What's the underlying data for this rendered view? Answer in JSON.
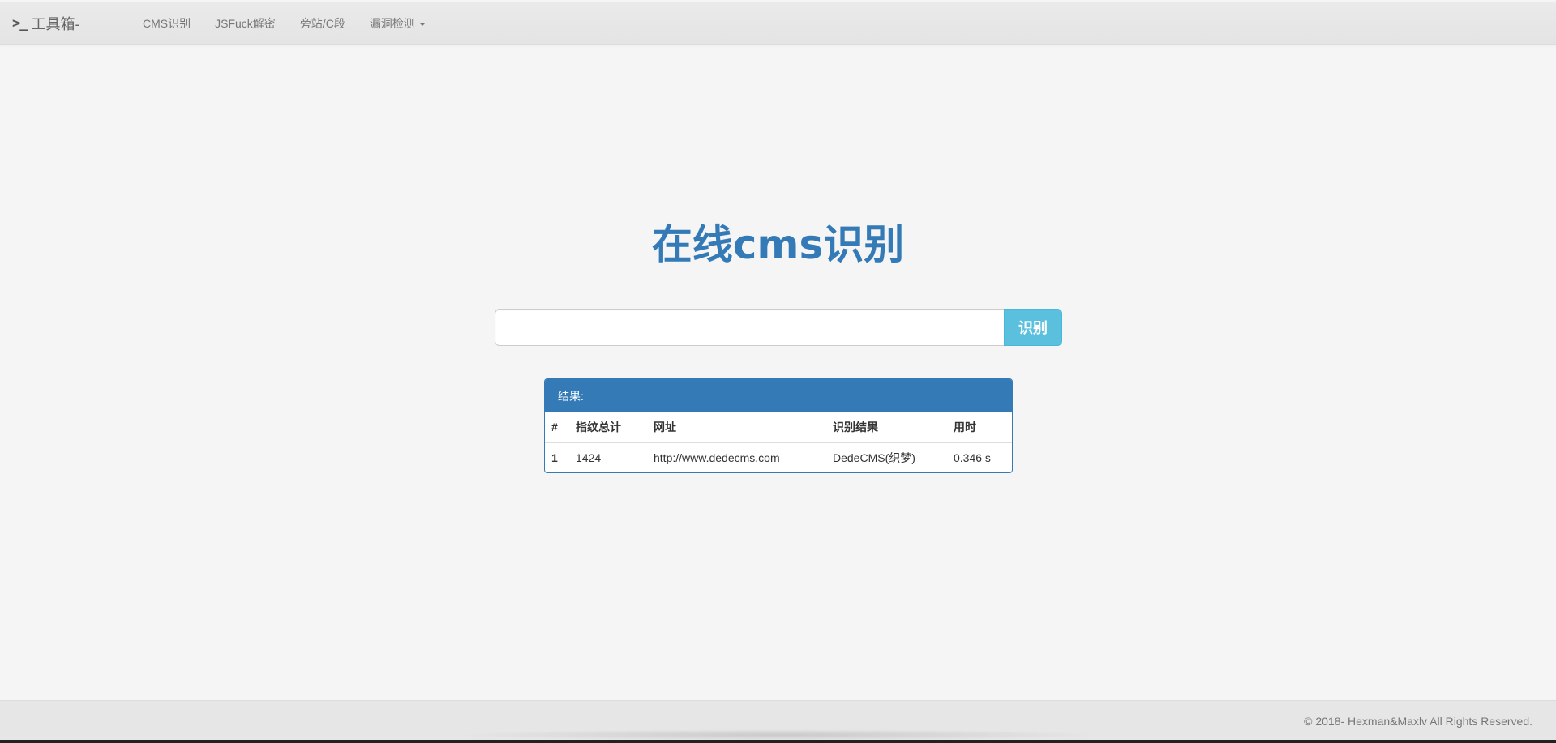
{
  "navbar": {
    "brand_icon": ">_",
    "brand_text": "工具箱-",
    "items": [
      {
        "label": "CMS识别"
      },
      {
        "label": "JSFuck解密"
      },
      {
        "label": "旁站/C段"
      },
      {
        "label": "漏洞检测",
        "has_dropdown": true
      }
    ]
  },
  "main": {
    "title": "在线cms识别",
    "search": {
      "value": "",
      "placeholder": "",
      "button_label": "识别"
    },
    "result": {
      "heading": "结果:",
      "columns": [
        "#",
        "指纹总计",
        "网址",
        "识别结果",
        "用时"
      ],
      "rows": [
        [
          "1",
          "1424",
          "http://www.dedecms.com",
          "DedeCMS(织梦)",
          "0.346 s"
        ]
      ]
    }
  },
  "footer": {
    "text": "© 2018- Hexman&Maxlv All Rights Reserved."
  },
  "colors": {
    "primary": "#337ab7",
    "info": "#5bc0de",
    "background": "#f5f5f5",
    "navbar": "#e6e6e6"
  }
}
